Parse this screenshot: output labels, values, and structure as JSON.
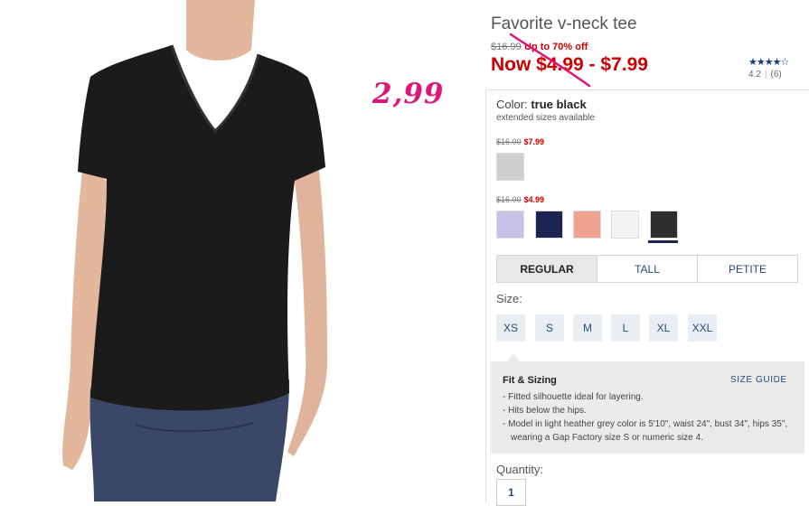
{
  "product": {
    "title": "Favorite v-neck tee",
    "original_price": "$16.99",
    "discount_text": "Up to 70% off",
    "now_price": "Now $4.99 - $7.99",
    "rating": {
      "stars": "★★★★☆",
      "score": "4.2",
      "count": "(6)"
    }
  },
  "annotation": {
    "price_note": "2,99",
    "color": "#e0157a"
  },
  "color": {
    "label": "Color:",
    "selected": "true black",
    "extended_note": "extended sizes available",
    "groups": [
      {
        "old": "$16.00",
        "new": "$7.99",
        "swatches": [
          "light heather grey"
        ]
      },
      {
        "old": "$16.00",
        "new": "$4.99",
        "swatches": [
          "lavender",
          "navy",
          "coral",
          "white",
          "true black"
        ]
      }
    ]
  },
  "fit_tabs": [
    "REGULAR",
    "TALL",
    "PETITE"
  ],
  "size": {
    "label": "Size:",
    "options": [
      "XS",
      "S",
      "M",
      "L",
      "XL",
      "XXL"
    ]
  },
  "fit_sizing": {
    "title": "Fit & Sizing",
    "size_guide": "SIZE GUIDE",
    "bullets": [
      "Fitted silhouette ideal for layering.",
      "Hits below the hips.",
      "Model in light heather grey color is 5'10\", waist 24\", bust 34\", hips 35\", wearing a Gap Factory size S or numeric size 4."
    ]
  },
  "quantity": {
    "label": "Quantity:",
    "value": "1"
  },
  "colors": {
    "sale_red": "#cc0000",
    "link_blue": "#2a4a7a",
    "annotation_pink": "#e0157a"
  }
}
